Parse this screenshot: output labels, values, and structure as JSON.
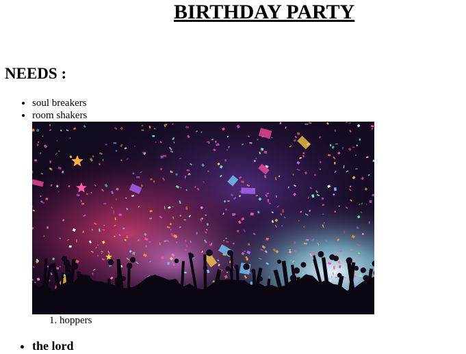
{
  "document": {
    "title": "BIRTHDAY PARTY",
    "section_heading": "NEEDS :",
    "needs": [
      "soul breakers",
      "room shakers"
    ],
    "ordered_items": [
      "hoppers"
    ],
    "bold_items": [
      "the lord"
    ]
  },
  "colors": {
    "background": "#ffffff",
    "text": "#000000"
  }
}
